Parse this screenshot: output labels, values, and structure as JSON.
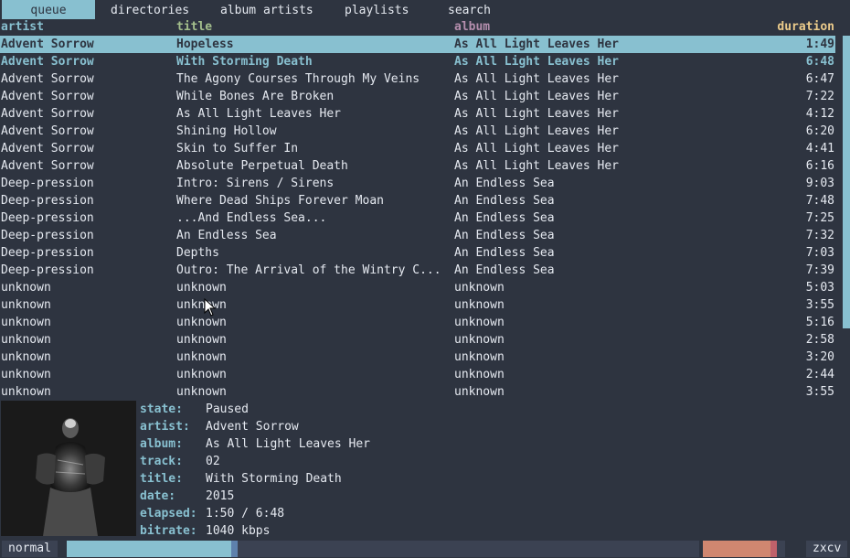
{
  "tabs": [
    "queue",
    "directories",
    "album artists",
    "playlists",
    "search"
  ],
  "headers": {
    "artist": "artist",
    "title": "title",
    "album": "album",
    "duration": "duration"
  },
  "colors": {
    "accent": "#88c0d0",
    "title_header": "#a3be8c",
    "album_header": "#b48ead",
    "duration_header": "#ebcb8b",
    "background": "#2e3440",
    "volume": "#d08770"
  },
  "queue": [
    {
      "artist": "Advent Sorrow",
      "title": "Hopeless",
      "album": "As All Light Leaves Her",
      "duration": "1:49"
    },
    {
      "artist": "Advent Sorrow",
      "title": "With Storming Death",
      "album": "As All Light Leaves Her",
      "duration": "6:48"
    },
    {
      "artist": "Advent Sorrow",
      "title": "The Agony Courses Through My Veins",
      "album": "As All Light Leaves Her",
      "duration": "6:47"
    },
    {
      "artist": "Advent Sorrow",
      "title": "While Bones Are Broken",
      "album": "As All Light Leaves Her",
      "duration": "7:22"
    },
    {
      "artist": "Advent Sorrow",
      "title": "As All Light Leaves Her",
      "album": "As All Light Leaves Her",
      "duration": "4:12"
    },
    {
      "artist": "Advent Sorrow",
      "title": "Shining Hollow",
      "album": "As All Light Leaves Her",
      "duration": "6:20"
    },
    {
      "artist": "Advent Sorrow",
      "title": "Skin to Suffer In",
      "album": "As All Light Leaves Her",
      "duration": "4:41"
    },
    {
      "artist": "Advent Sorrow",
      "title": "Absolute Perpetual Death",
      "album": "As All Light Leaves Her",
      "duration": "6:16"
    },
    {
      "artist": "Deep-pression",
      "title": "Intro: Sirens / Sirens",
      "album": "An Endless Sea",
      "duration": "9:03"
    },
    {
      "artist": "Deep-pression",
      "title": "Where Dead Ships Forever Moan",
      "album": "An Endless Sea",
      "duration": "7:48"
    },
    {
      "artist": "Deep-pression",
      "title": "...And Endless Sea...",
      "album": "An Endless Sea",
      "duration": "7:25"
    },
    {
      "artist": "Deep-pression",
      "title": "An Endless Sea",
      "album": "An Endless Sea",
      "duration": "7:32"
    },
    {
      "artist": "Deep-pression",
      "title": "Depths",
      "album": "An Endless Sea",
      "duration": "7:03"
    },
    {
      "artist": "Deep-pression",
      "title": "Outro: The Arrival of the Wintry C...",
      "album": "An Endless Sea",
      "duration": "7:39"
    },
    {
      "artist": "unknown",
      "title": "unknown",
      "album": "unknown",
      "duration": "5:03"
    },
    {
      "artist": "unknown",
      "title": "unknown",
      "album": "unknown",
      "duration": "3:55"
    },
    {
      "artist": "unknown",
      "title": "unknown",
      "album": "unknown",
      "duration": "5:16"
    },
    {
      "artist": "unknown",
      "title": "unknown",
      "album": "unknown",
      "duration": "2:58"
    },
    {
      "artist": "unknown",
      "title": "unknown",
      "album": "unknown",
      "duration": "3:20"
    },
    {
      "artist": "unknown",
      "title": "unknown",
      "album": "unknown",
      "duration": "2:44"
    },
    {
      "artist": "unknown",
      "title": "unknown",
      "album": "unknown",
      "duration": "3:55"
    }
  ],
  "info": [
    {
      "key": "state:",
      "value": "Paused"
    },
    {
      "key": "artist:",
      "value": "Advent Sorrow"
    },
    {
      "key": "album:",
      "value": "As All Light Leaves Her"
    },
    {
      "key": "track:",
      "value": "02"
    },
    {
      "key": "title:",
      "value": "With Storming Death"
    },
    {
      "key": "date:",
      "value": "2015"
    },
    {
      "key": "elapsed:",
      "value": "1:50 / 6:48"
    },
    {
      "key": "bitrate:",
      "value": "1040 kbps"
    }
  ],
  "status": {
    "mode": "normal",
    "progress_fraction": 0.27,
    "volume_fraction": 0.9,
    "host": "zxcv"
  }
}
